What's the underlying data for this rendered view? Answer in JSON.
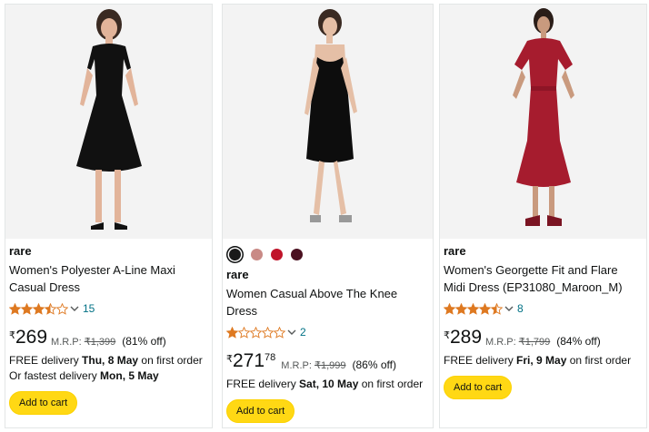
{
  "products": [
    {
      "brand": "rare",
      "title": "Women's Polyester A-Line Maxi Casual Dress",
      "rating": 3.5,
      "rating_count": "15",
      "price": {
        "currency": "₹",
        "whole": "269",
        "fraction": ""
      },
      "mrp_label": "M.R.P:",
      "mrp": "₹1,399",
      "discount": "(81% off)",
      "delivery": {
        "prefix": "FREE delivery",
        "date": "Thu, 8 May",
        "suffix": "on first order"
      },
      "fast_delivery": {
        "prefix": "Or fastest delivery",
        "date": "Mon, 5 May"
      },
      "button": "Add to cart"
    },
    {
      "brand": "rare",
      "title": "Women Casual Above The Knee Dress",
      "rating": 1,
      "rating_count": "2",
      "price": {
        "currency": "₹",
        "whole": "271",
        "fraction": "78"
      },
      "mrp_label": "M.R.P:",
      "mrp": "₹1,999",
      "discount": "(86% off)",
      "delivery": {
        "prefix": "FREE delivery",
        "date": "Sat, 10 May",
        "suffix": "on first order"
      },
      "swatches": [
        "#1a1a1a",
        "#c98a86",
        "#c0142a",
        "#4a1020"
      ],
      "button": "Add to cart"
    },
    {
      "brand": "rare",
      "title": "Women's Georgette Fit and Flare Midi Dress (EP31080_Maroon_M)",
      "rating": 4.5,
      "rating_count": "8",
      "price": {
        "currency": "₹",
        "whole": "289",
        "fraction": ""
      },
      "mrp_label": "M.R.P:",
      "mrp": "₹1,799",
      "discount": "(84% off)",
      "delivery": {
        "prefix": "FREE delivery",
        "date": "Fri, 9 May",
        "suffix": "on first order"
      },
      "button": "Add to cart"
    }
  ],
  "colors": {
    "star": "#de7921",
    "link": "#007185",
    "button": "#ffd814"
  },
  "icons": {
    "star": "star-icon",
    "chevron": "chevron-down-icon"
  }
}
